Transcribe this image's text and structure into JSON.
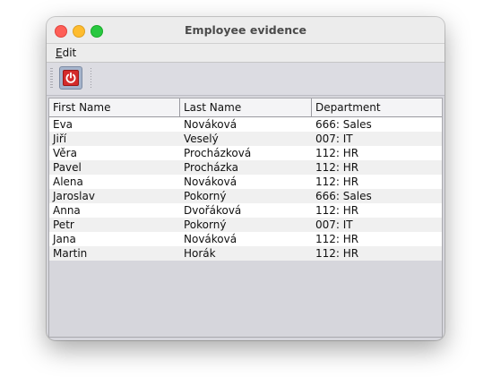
{
  "window": {
    "title": "Employee evidence"
  },
  "menubar": {
    "items": [
      {
        "label_first": "E",
        "label_rest": "dit"
      }
    ]
  },
  "toolbar": {
    "power_icon": "power-icon",
    "power_color": "#d42b2b"
  },
  "table": {
    "columns": [
      "First Name",
      "Last Name",
      "Department"
    ],
    "rows": [
      [
        "Eva",
        "Nováková",
        "666: Sales"
      ],
      [
        "Jiří",
        "Veselý",
        "007: IT"
      ],
      [
        "Věra",
        "Procházková",
        "112: HR"
      ],
      [
        "Pavel",
        "Procházka",
        "112: HR"
      ],
      [
        "Alena",
        "Nováková",
        "112: HR"
      ],
      [
        "Jaroslav",
        "Pokorný",
        "666: Sales"
      ],
      [
        "Anna",
        "Dvořáková",
        "112: HR"
      ],
      [
        "Petr",
        "Pokorný",
        "007: IT"
      ],
      [
        "Jana",
        "Nováková",
        "112: HR"
      ],
      [
        "Martin",
        "Horák",
        "112: HR"
      ]
    ]
  }
}
